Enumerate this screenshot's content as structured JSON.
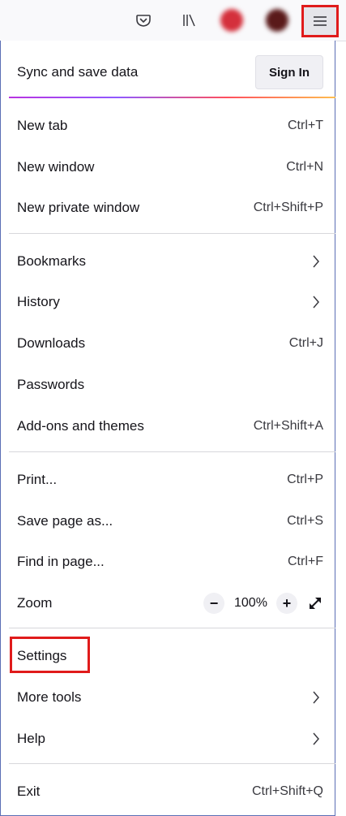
{
  "toolbar": {
    "pocket_icon": "pocket-icon",
    "library_icon": "library-icon",
    "menu_icon": "hamburger-menu-icon",
    "avatar1_color": "#d4303c",
    "avatar2_color": "#5a1a1a"
  },
  "sync": {
    "label": "Sync and save data",
    "signin": "Sign In"
  },
  "menu": {
    "new_tab": {
      "label": "New tab",
      "shortcut": "Ctrl+T"
    },
    "new_window": {
      "label": "New window",
      "shortcut": "Ctrl+N"
    },
    "new_private": {
      "label": "New private window",
      "shortcut": "Ctrl+Shift+P"
    },
    "bookmarks": {
      "label": "Bookmarks"
    },
    "history": {
      "label": "History"
    },
    "downloads": {
      "label": "Downloads",
      "shortcut": "Ctrl+J"
    },
    "passwords": {
      "label": "Passwords"
    },
    "addons": {
      "label": "Add-ons and themes",
      "shortcut": "Ctrl+Shift+A"
    },
    "print": {
      "label": "Print...",
      "shortcut": "Ctrl+P"
    },
    "save_page": {
      "label": "Save page as...",
      "shortcut": "Ctrl+S"
    },
    "find": {
      "label": "Find in page...",
      "shortcut": "Ctrl+F"
    },
    "zoom": {
      "label": "Zoom",
      "minus": "−",
      "value": "100%",
      "plus": "+"
    },
    "settings": {
      "label": "Settings"
    },
    "more_tools": {
      "label": "More tools"
    },
    "help": {
      "label": "Help"
    },
    "exit": {
      "label": "Exit",
      "shortcut": "Ctrl+Shift+Q"
    }
  },
  "colors": {
    "highlight": "#e01b1b",
    "panel_border": "#5b6fb5"
  }
}
